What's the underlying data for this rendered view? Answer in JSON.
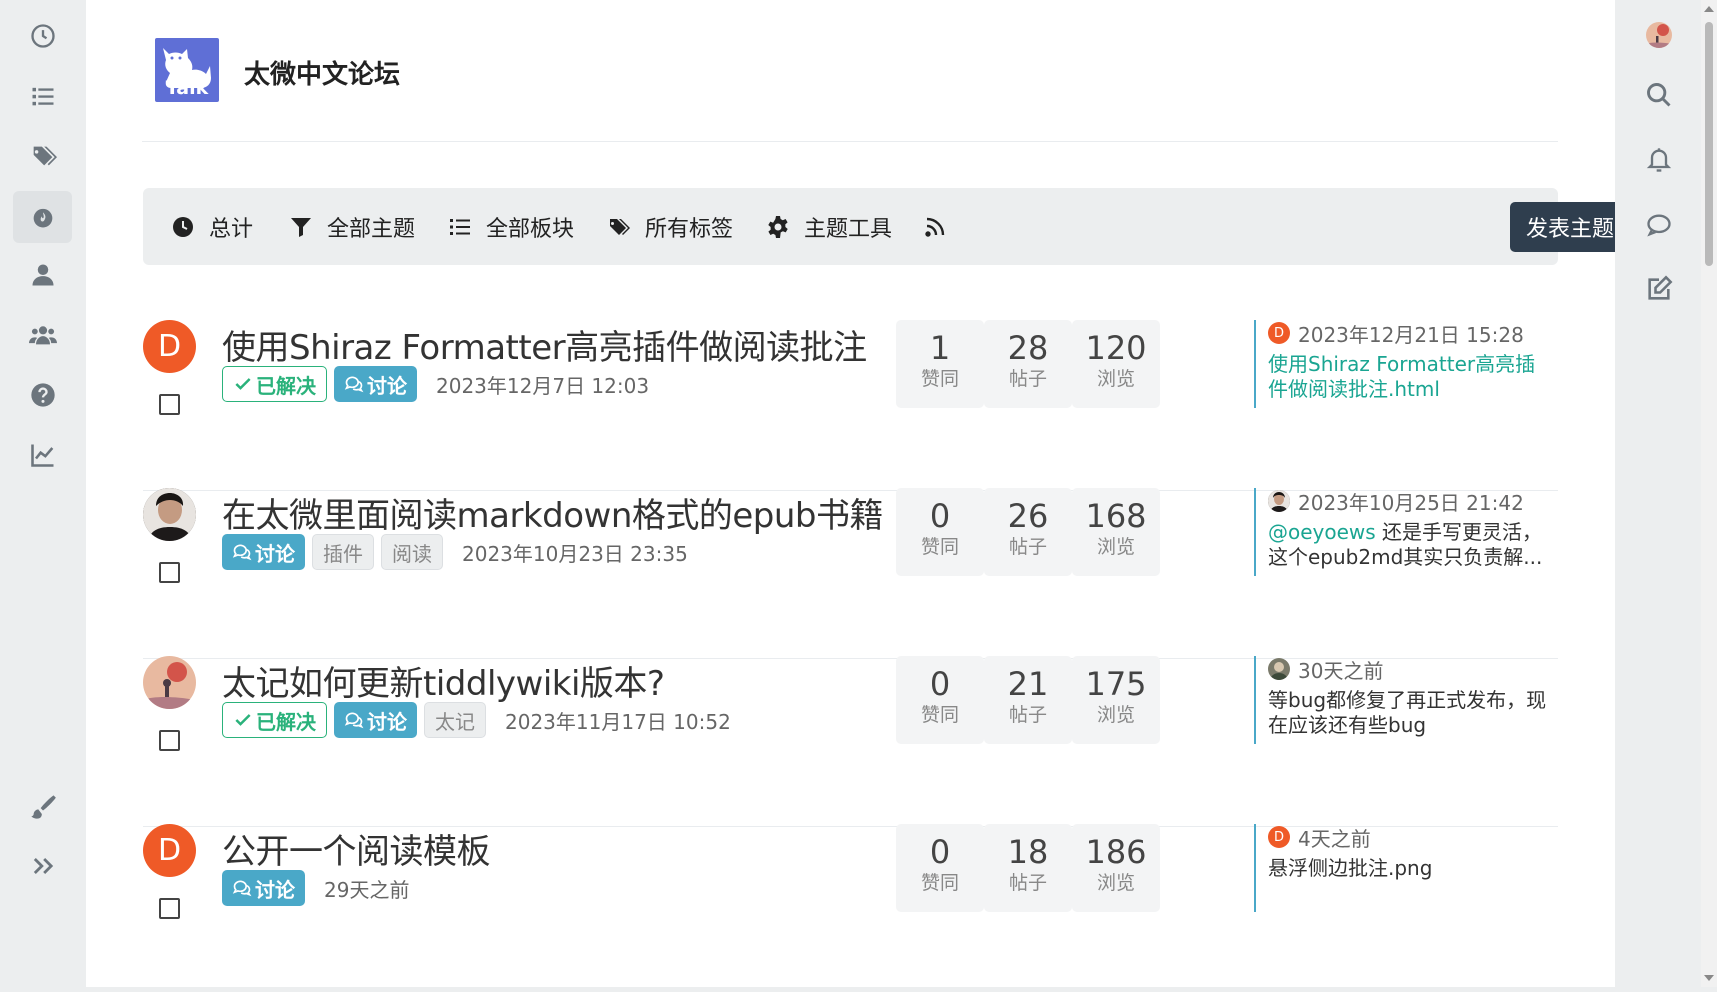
{
  "left_nav": [
    {
      "icon": "clock-icon",
      "label": "recent"
    },
    {
      "icon": "list-icon",
      "label": "topics"
    },
    {
      "icon": "tags-icon",
      "label": "tags"
    },
    {
      "icon": "fire-icon",
      "label": "popular",
      "active": true
    },
    {
      "icon": "user-icon",
      "label": "users"
    },
    {
      "icon": "users-icon",
      "label": "groups"
    },
    {
      "icon": "help-icon",
      "label": "help"
    },
    {
      "icon": "chart-icon",
      "label": "stats"
    },
    {
      "icon": "brush-icon",
      "label": "skin"
    },
    {
      "icon": "double-chevron-icon",
      "label": "expand"
    }
  ],
  "header": {
    "logo_text": "Talk",
    "site_title": "太微中文论坛"
  },
  "toolbar": {
    "items": [
      "总计",
      "全部主题",
      "全部板块",
      "所有标签",
      "主题工具"
    ],
    "rss_icon": "rss-icon",
    "post_button": "发表主题"
  },
  "topics": [
    {
      "avatar_letter": "D",
      "title": "使用Shiraz Formatter高亮插件做阅读批注",
      "badges": {
        "solved": "已解决",
        "discuss": "讨论",
        "tags": []
      },
      "date": "2023年12月7日 12:03",
      "likes": "1",
      "likes_label": "赞同",
      "posts": "28",
      "posts_label": "帖子",
      "views": "120",
      "views_label": "浏览",
      "last_time": "2023年12月21日 15:28",
      "last_avatar_letter": "D",
      "last_text": "",
      "last_link": "使用Shiraz Formatter高亮插件做阅读批注.html"
    },
    {
      "avatar_letter": "",
      "title": "在太微里面阅读markdown格式的epub书籍",
      "badges": {
        "solved": "",
        "discuss": "讨论",
        "tags": [
          "插件",
          "阅读"
        ]
      },
      "date": "2023年10月23日 23:35",
      "likes": "0",
      "likes_label": "赞同",
      "posts": "26",
      "posts_label": "帖子",
      "views": "168",
      "views_label": "浏览",
      "last_time": "2023年10月25日 21:42",
      "last_avatar_letter": "",
      "last_link": "@oeyoews",
      "last_text": " 还是手写更灵活，这个epub2md其实只负责解..."
    },
    {
      "avatar_letter": "",
      "title": "太记如何更新tiddlywiki版本?",
      "badges": {
        "solved": "已解决",
        "discuss": "讨论",
        "tags": [
          "太记"
        ]
      },
      "date": "2023年11月17日 10:52",
      "likes": "0",
      "likes_label": "赞同",
      "posts": "21",
      "posts_label": "帖子",
      "views": "175",
      "views_label": "浏览",
      "last_time": "30天之前",
      "last_avatar_letter": "",
      "last_link": "",
      "last_text": "等bug都修复了再正式发布，现在应该还有些bug"
    },
    {
      "avatar_letter": "D",
      "title": "公开一个阅读模板",
      "badges": {
        "solved": "",
        "discuss": "讨论",
        "tags": []
      },
      "date": "29天之前",
      "likes": "0",
      "likes_label": "赞同",
      "posts": "18",
      "posts_label": "帖子",
      "views": "186",
      "views_label": "浏览",
      "last_time": "4天之前",
      "last_avatar_letter": "D",
      "last_link": "",
      "last_text": "悬浮侧边批注.png"
    }
  ],
  "right_nav": [
    "user-avatar",
    "search-icon",
    "bell-icon",
    "chat-icon",
    "edit-icon"
  ]
}
